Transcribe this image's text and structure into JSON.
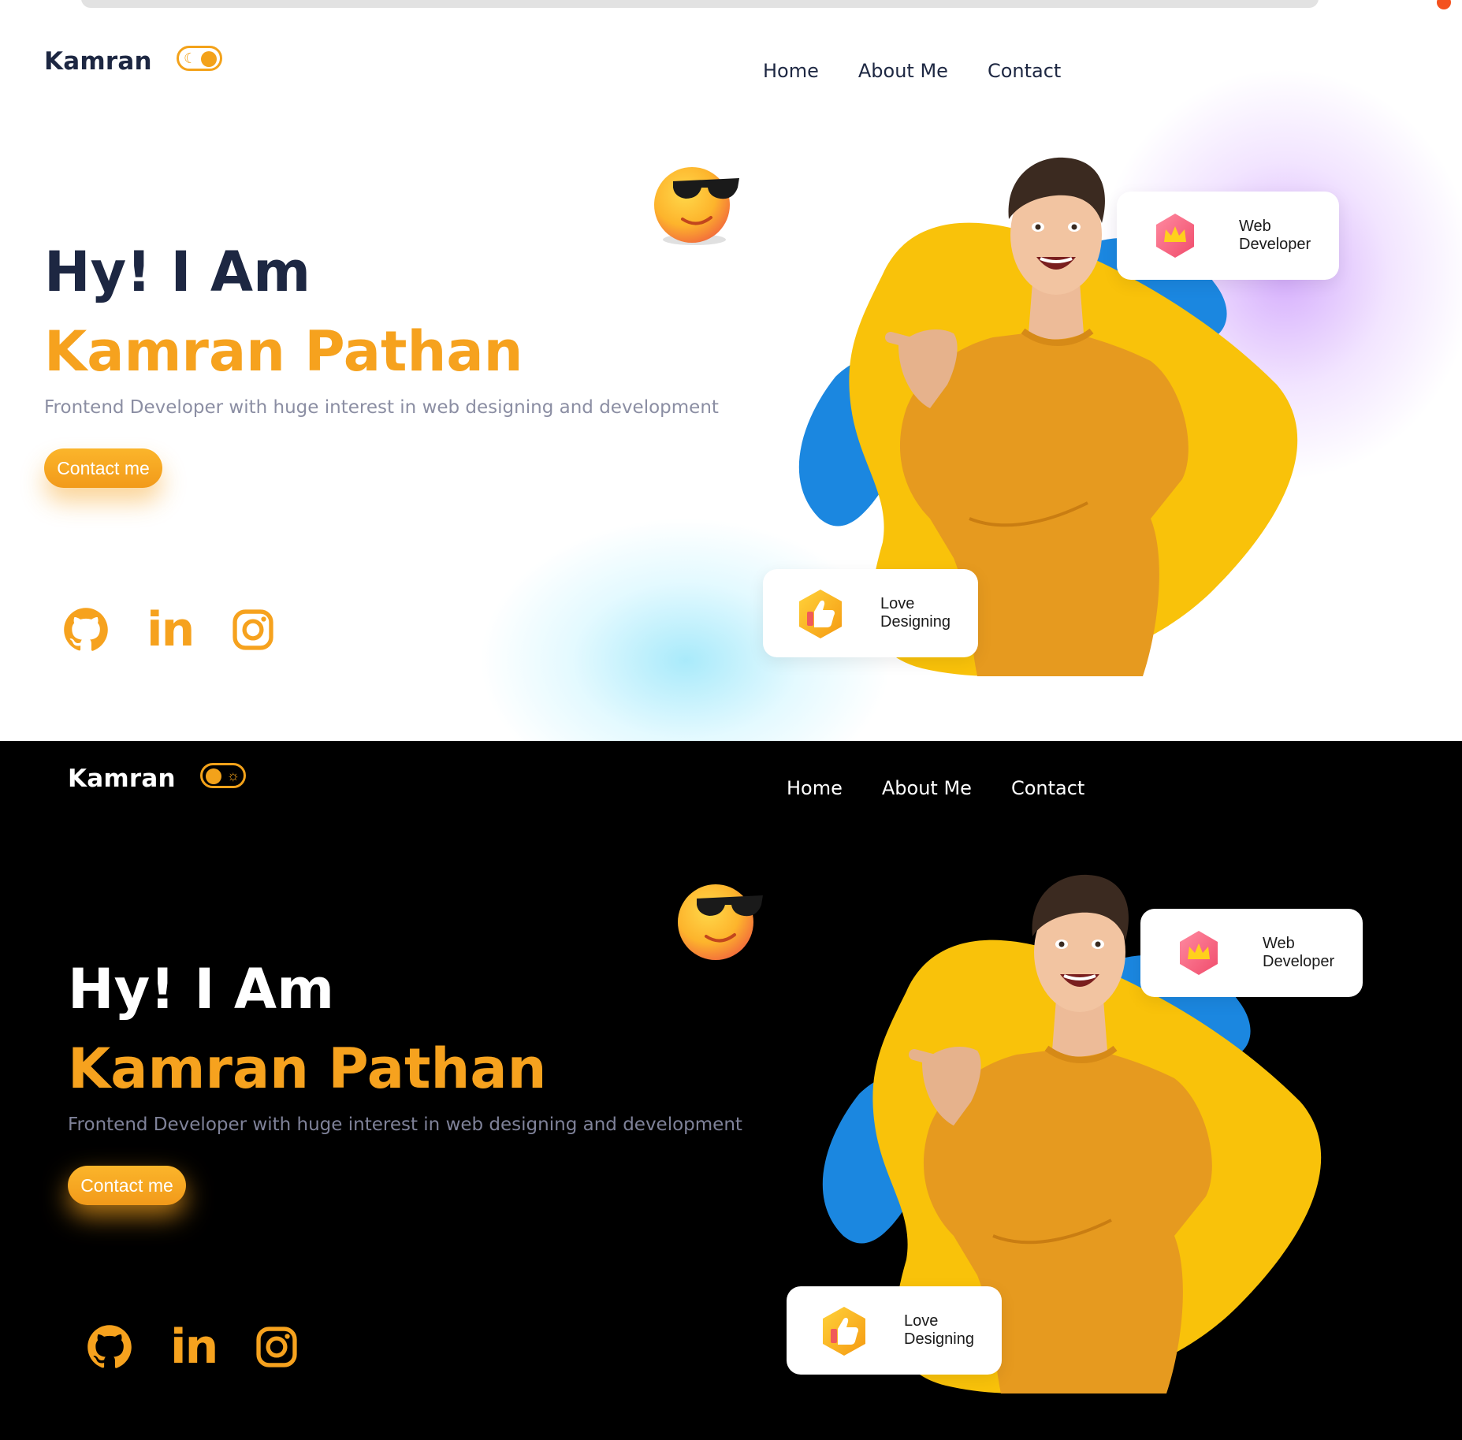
{
  "brand": {
    "name": "Kamran"
  },
  "nav": {
    "items": [
      "Home",
      "About Me",
      "Contact"
    ]
  },
  "hero": {
    "greeting": "Hy! I Am",
    "name": "Kamran Pathan",
    "subtitle": "Frontend Developer with huge interest in web designing and development",
    "cta_label": "Contact me"
  },
  "cards": {
    "web": {
      "line1": "Web",
      "line2": "Developer",
      "icon": "crown-icon"
    },
    "love": {
      "line1": "Love",
      "line2": "Designing",
      "icon": "thumbs-up-icon"
    }
  },
  "socials": [
    {
      "name": "github",
      "icon": "github-icon"
    },
    {
      "name": "linkedin",
      "icon": "linkedin-icon",
      "glyph": "in"
    },
    {
      "name": "instagram",
      "icon": "instagram-icon"
    }
  ],
  "themes": {
    "light": {
      "mode": "light",
      "toggle_icon": "moon-icon",
      "background": "#ffffff",
      "text": "#1d2742"
    },
    "dark": {
      "mode": "dark",
      "toggle_icon": "sun-icon",
      "background": "#000000",
      "text": "#ffffff"
    }
  },
  "colors": {
    "accent": "#f6a21e",
    "blob_yellow": "#f9c20a",
    "blob_blue": "#1b87e0",
    "sweater": "#e69a1f"
  }
}
